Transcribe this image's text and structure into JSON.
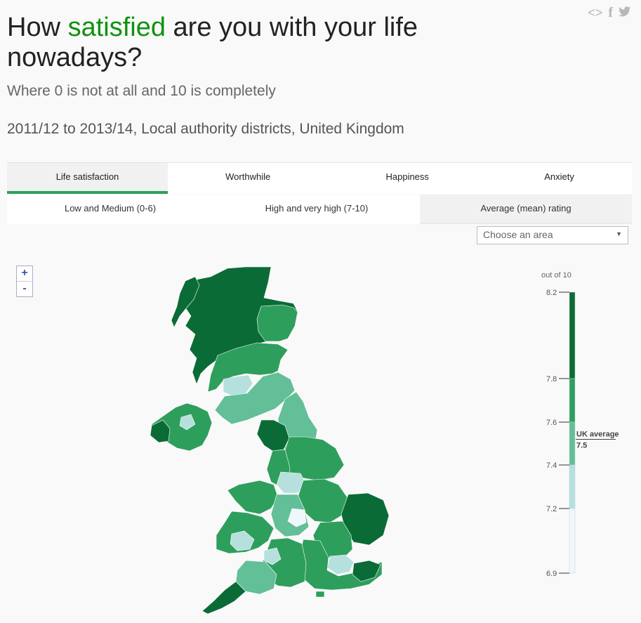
{
  "share": {
    "embed_icon": "code-icon",
    "facebook_icon": "facebook-icon",
    "twitter_icon": "twitter-icon"
  },
  "title": {
    "before": "How ",
    "highlight": "satisfied",
    "after": " are you with your life nowadays?"
  },
  "subtitle": "Where 0 is not at all and 10 is completely",
  "period": "2011/12 to 2013/14, Local authority districts, United Kingdom",
  "measure_tabs": [
    "Life satisfaction",
    "Worthwhile",
    "Happiness",
    "Anxiety"
  ],
  "active_measure": "Life satisfaction",
  "view_tabs": [
    "Low and Medium (0-6)",
    "High and very high (7-10)",
    "Average (mean) rating"
  ],
  "active_view": "Average (mean) rating",
  "area_select": {
    "placeholder": "Choose an area"
  },
  "zoom": {
    "in": "+",
    "out": "-"
  },
  "legend": {
    "unit": "out of 10",
    "ticks": [
      "8.2",
      "7.8",
      "7.6",
      "7.4",
      "7.2",
      "6.9"
    ],
    "scale_min": 6.9,
    "scale_max": 8.2,
    "bands": [
      {
        "from": 7.8,
        "to": 8.2,
        "color": "#0b6b36"
      },
      {
        "from": 7.6,
        "to": 7.8,
        "color": "#2e9e5c"
      },
      {
        "from": 7.4,
        "to": 7.6,
        "color": "#62bf97"
      },
      {
        "from": 7.2,
        "to": 7.4,
        "color": "#b5e0dd"
      },
      {
        "from": 6.9,
        "to": 7.2,
        "color": "#eef7fa"
      }
    ],
    "uk_average_label": "UK average",
    "uk_average_value": "7.5"
  }
}
